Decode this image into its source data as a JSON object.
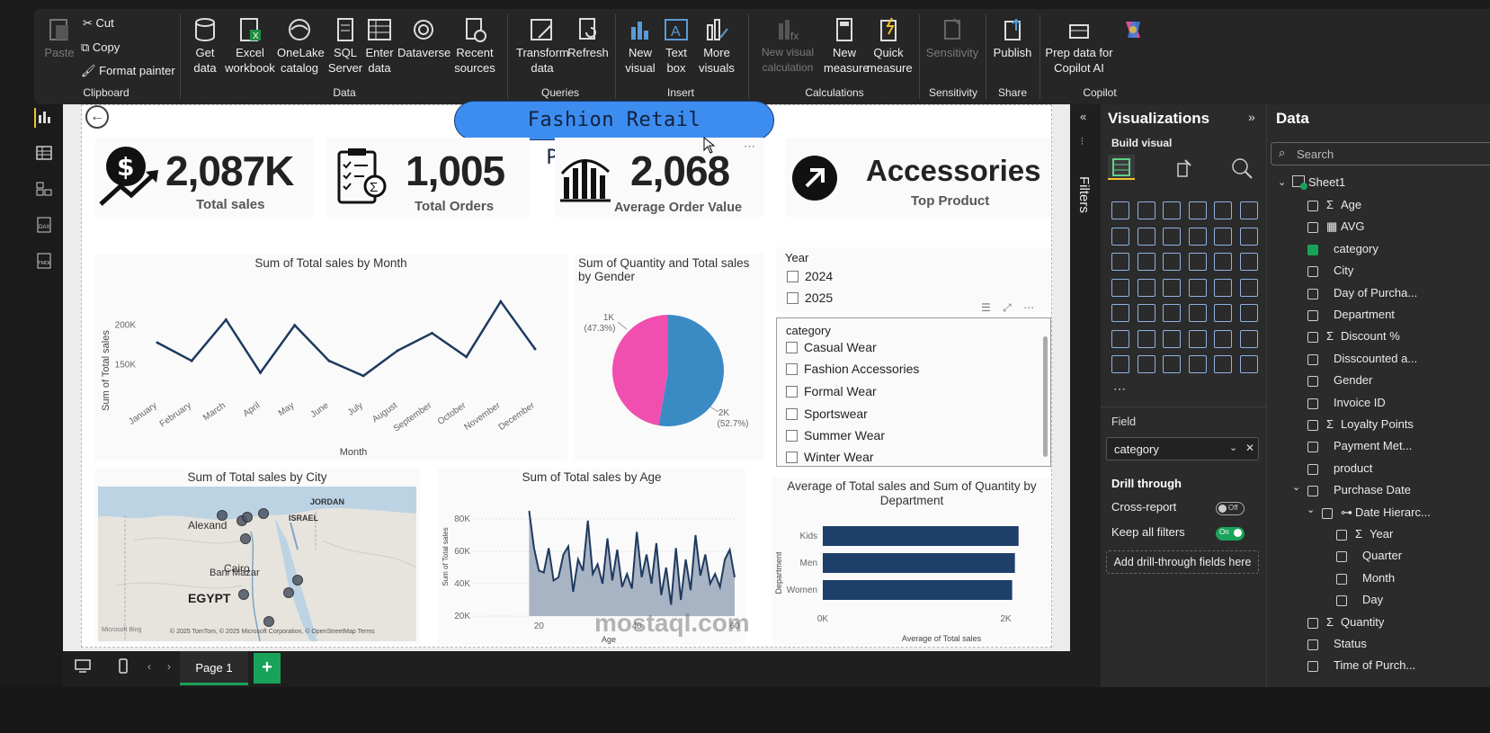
{
  "ribbon": {
    "clipboard": {
      "paste": "Paste",
      "cut": "Cut",
      "copy": "Copy",
      "format_painter": "Format painter",
      "group": "Clipboard"
    },
    "data": {
      "get_data": "Get data",
      "excel": "Excel workbook",
      "onelake": "OneLake catalog",
      "sql": "SQL Server",
      "enter": "Enter data",
      "dataverse": "Dataverse",
      "recent": "Recent sources",
      "group": "Data"
    },
    "queries": {
      "transform": "Transform data",
      "refresh": "Refresh",
      "group": "Queries"
    },
    "insert": {
      "new_visual": "New visual",
      "text_box": "Text box",
      "more_visuals": "More visuals",
      "group": "Insert"
    },
    "calculations": {
      "new_visual_calc": "New visual calculation",
      "new_measure": "New measure",
      "quick_measure": "Quick measure",
      "group": "Calculations"
    },
    "sensitivity": {
      "label": "Sensitivity",
      "group": "Sensitivity"
    },
    "share": {
      "publish": "Publish",
      "group": "Share"
    },
    "copilot": {
      "prep": "Prep data for Copilot AI",
      "group": "Copilot"
    }
  },
  "report": {
    "title": "Fashion Retail Performance",
    "kpis": [
      {
        "value": "2,087K",
        "label": "Total sales",
        "icon": "dollar-growth-icon"
      },
      {
        "value": "1,005",
        "label": "Total Orders",
        "icon": "clipboard-checklist-icon"
      },
      {
        "value": "2,068",
        "label": "Average Order Value",
        "icon": "bar-chart-icon"
      },
      {
        "value": "Accessories",
        "label": "Top Product",
        "icon": "arrow-up-right-icon"
      }
    ],
    "slicer_year": {
      "title": "Year",
      "options": [
        "2024",
        "2025"
      ]
    },
    "slicer_category": {
      "title": "category",
      "options": [
        "Casual Wear",
        "Fashion Accessories",
        "Formal Wear",
        "Sportswear",
        "Summer Wear",
        "Winter Wear"
      ]
    },
    "map": {
      "title": "Sum of Total sales by City",
      "labels": {
        "alexandria": "Alexand",
        "cairo": "Cairo",
        "bani_mazar": "Bani Mazar",
        "egypt": "EGYPT",
        "israel": "ISRAEL",
        "jordan": "JORDAN"
      },
      "attribution": "© 2025 TomTom, © 2025 Microsoft Corporation, © OpenStreetMap  Terms",
      "bing": "Microsoft Bing"
    }
  },
  "chart_data": [
    {
      "type": "line",
      "title": "Sum of Total sales by Month",
      "xlabel": "Month",
      "ylabel": "Sum of Total sales",
      "categories": [
        "January",
        "February",
        "March",
        "April",
        "May",
        "June",
        "July",
        "August",
        "September",
        "October",
        "November",
        "December"
      ],
      "values": [
        178000,
        155000,
        207000,
        140000,
        200000,
        155000,
        136000,
        168000,
        190000,
        160000,
        230000,
        170000
      ],
      "yticks": [
        "150K",
        "200K"
      ],
      "ylim": [
        120000,
        245000
      ]
    },
    {
      "type": "pie",
      "title": "Sum of Quantity and Total sales by Gender",
      "slices": [
        {
          "label": "1K",
          "pct": "(47.3%)",
          "value": 47.3,
          "color": "#f04fb0"
        },
        {
          "label": "2K",
          "pct": "(52.7%)",
          "value": 52.7,
          "color": "#3a8ac4"
        }
      ]
    },
    {
      "type": "area",
      "title": "Sum of Total sales by Age",
      "xlabel": "Age",
      "ylabel": "Sum of Total sales",
      "x": [
        18,
        19,
        20,
        21,
        22,
        23,
        24,
        25,
        26,
        27,
        28,
        29,
        30,
        31,
        32,
        33,
        34,
        35,
        36,
        37,
        38,
        39,
        40,
        41,
        42,
        43,
        44,
        45,
        46,
        47,
        48,
        49,
        50,
        51,
        52,
        53,
        54,
        55,
        56,
        57,
        58,
        59,
        60
      ],
      "values": [
        85000,
        62000,
        48000,
        47000,
        62000,
        42000,
        44000,
        58000,
        63000,
        35000,
        55000,
        48000,
        79000,
        46000,
        52000,
        40000,
        68000,
        42000,
        61000,
        38000,
        46000,
        37000,
        72000,
        44000,
        58000,
        40000,
        65000,
        33000,
        50000,
        27000,
        62000,
        30000,
        55000,
        36000,
        70000,
        45000,
        58000,
        40000,
        46000,
        38000,
        55000,
        61000,
        44000
      ],
      "xticks": [
        "20",
        "40",
        "60"
      ],
      "yticks": [
        "20K",
        "40K",
        "60K",
        "80K"
      ],
      "ylim": [
        20000,
        90000
      ],
      "xlim": [
        17,
        60
      ]
    },
    {
      "type": "bar",
      "orientation": "horizontal",
      "title": "Average of Total sales and Sum of Quantity by Department",
      "xlabel": "Average of Total sales",
      "ylabel": "Department",
      "categories": [
        "Kids",
        "Men",
        "Women"
      ],
      "values": [
        2140,
        2100,
        2070
      ],
      "xticks": [
        "0K",
        "2K"
      ],
      "xlim": [
        0,
        2300
      ]
    }
  ],
  "panes": {
    "filters": "Filters",
    "visualizations": {
      "title": "Visualizations",
      "build": "Build visual",
      "field": "Field",
      "field_value": "category",
      "drill": "Drill through",
      "cross_report": "Cross-report",
      "cross_state": "Off",
      "keep_filters": "Keep all filters",
      "keep_state": "On",
      "add_drill": "Add drill-through fields here"
    },
    "data": {
      "title": "Data",
      "search": "Search",
      "table": "Sheet1",
      "fields": [
        "Age",
        "AVG",
        "category",
        "City",
        "Day of Purcha...",
        "Department",
        "Discount %",
        "Disscounted a...",
        "Gender",
        "Invoice ID",
        "Loyalty Points",
        "Payment Met...",
        "product",
        "Purchase Date",
        "Date Hierarc...",
        "Year",
        "Quarter",
        "Month",
        "Day",
        "Quantity",
        "Status",
        "Time of Purch..."
      ]
    }
  },
  "bottom": {
    "page": "Page 1",
    "add": "+"
  },
  "watermark": "mostaql.com"
}
